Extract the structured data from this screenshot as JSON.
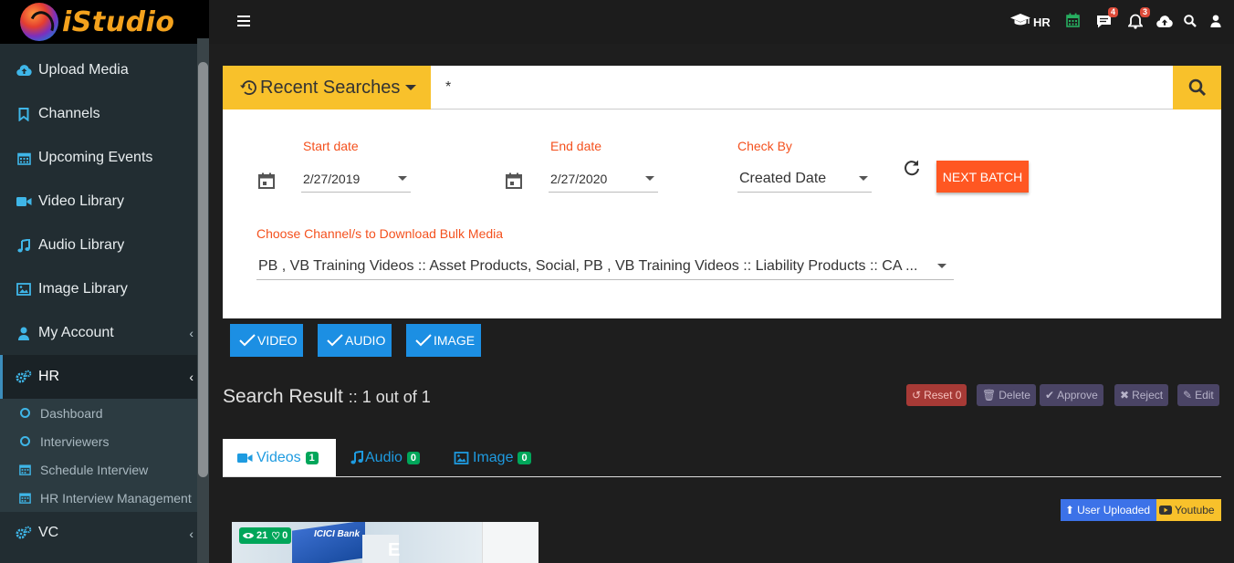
{
  "app": {
    "brand": "iStudio"
  },
  "sidebar": {
    "items": [
      {
        "label": "Upload Media",
        "icon": "cloud-upload-icon"
      },
      {
        "label": "Channels",
        "icon": "bookmark-icon"
      },
      {
        "label": "Upcoming Events",
        "icon": "calendar-icon"
      },
      {
        "label": "Video Library",
        "icon": "video-camera-icon"
      },
      {
        "label": "Audio Library",
        "icon": "music-note-icon"
      },
      {
        "label": "Image Library",
        "icon": "image-icon"
      },
      {
        "label": "My Account",
        "icon": "user-icon"
      },
      {
        "label": "HR",
        "icon": "gears-icon"
      },
      {
        "label": "VC",
        "icon": "gears-icon"
      }
    ],
    "hr_sub": [
      {
        "label": "Dashboard",
        "icon": "circle-icon"
      },
      {
        "label": "Interviewers",
        "icon": "circle-icon"
      },
      {
        "label": "Schedule Interview",
        "icon": "calendar-icon"
      },
      {
        "label": "HR Interview Management",
        "icon": "calendar-icon"
      }
    ]
  },
  "topbar": {
    "role_label": "HR",
    "messages_count": "4",
    "notifications_count": "3"
  },
  "search": {
    "recent_label": "Recent Searches",
    "query": "*"
  },
  "filters": {
    "start_date_label": "Start date",
    "start_date": "2/27/2019",
    "end_date_label": "End date",
    "end_date": "2/27/2020",
    "check_by_label": "Check By",
    "check_by": "Created Date",
    "next_batch": "NEXT BATCH",
    "channels_label": "Choose Channel/s to Download Bulk Media",
    "channels_value": "PB , VB Training Videos :: Asset Products, Social, PB , VB Training Videos :: Liability Products :: CA ..."
  },
  "types": {
    "video": "VIDEO",
    "audio": "AUDIO",
    "image": "IMAGE"
  },
  "results": {
    "title": "Search Result",
    "count": ":: 1 out of 1",
    "actions": {
      "reset": "Reset 0",
      "delete": "Delete",
      "approve": "Approve",
      "reject": "Reject",
      "edit": "Edit"
    }
  },
  "tabs": [
    {
      "label": "Videos",
      "count": "1"
    },
    {
      "label": "Audio",
      "count": "0"
    },
    {
      "label": "Image",
      "count": "0"
    }
  ],
  "sources": {
    "user_uploaded": "User Uploaded",
    "youtube": "Youtube"
  },
  "media_card": {
    "views": "21",
    "likes": "0",
    "thumb_text": "ICICI Bank",
    "thumb_letter": "E"
  },
  "colors": {
    "accent_yellow": "#f8c12b",
    "accent_blue": "#1c8fe3",
    "accent_orange": "#ff5722",
    "badge_green": "#00a65a"
  }
}
